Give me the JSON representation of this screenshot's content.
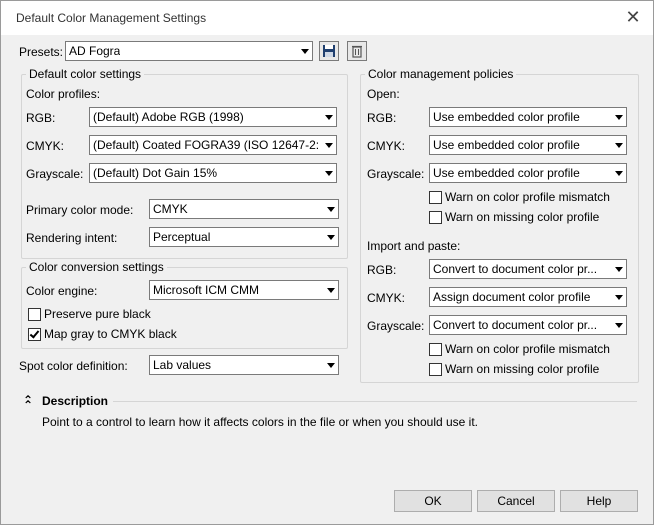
{
  "window": {
    "title": "Default Color Management Settings"
  },
  "presets": {
    "label": "Presets:",
    "value": "AD Fogra",
    "save_icon": "floppy-disk-icon",
    "delete_icon": "trash-icon"
  },
  "default_color": {
    "legend": "Default color settings",
    "profiles_label": "Color profiles:",
    "rgb_label": "RGB:",
    "rgb_value": "(Default) Adobe RGB (1998)",
    "cmyk_label": "CMYK:",
    "cmyk_value": "(Default) Coated FOGRA39 (ISO 12647-2:...",
    "gray_label": "Grayscale:",
    "gray_value": "(Default) Dot Gain 15%",
    "mode_label": "Primary color mode:",
    "mode_value": "CMYK",
    "intent_label": "Rendering intent:",
    "intent_value": "Perceptual"
  },
  "conversion": {
    "legend": "Color conversion settings",
    "engine_label": "Color engine:",
    "engine_value": "Microsoft ICM CMM",
    "preserve_label": "Preserve pure black",
    "preserve_checked": false,
    "map_gray_label": "Map gray to CMYK black",
    "map_gray_checked": true
  },
  "spot": {
    "label": "Spot color definition:",
    "value": "Lab values"
  },
  "policies": {
    "legend": "Color management policies",
    "open_label": "Open:",
    "open_rgb_label": "RGB:",
    "open_rgb_value": "Use embedded color profile",
    "open_cmyk_label": "CMYK:",
    "open_cmyk_value": "Use embedded color profile",
    "open_gray_label": "Grayscale:",
    "open_gray_value": "Use embedded color profile",
    "open_warn_mismatch": "Warn on color profile mismatch",
    "open_warn_missing": "Warn on missing color profile",
    "import_label": "Import and paste:",
    "imp_rgb_label": "RGB:",
    "imp_rgb_value": "Convert to document color pr...",
    "imp_cmyk_label": "CMYK:",
    "imp_cmyk_value": "Assign document color profile",
    "imp_gray_label": "Grayscale:",
    "imp_gray_value": "Convert to document color pr...",
    "imp_warn_mismatch": "Warn on color profile mismatch",
    "imp_warn_missing": "Warn on missing color profile"
  },
  "description": {
    "title": "Description",
    "text": "Point to a control to learn how it affects colors in the file or when you should use it.",
    "collapse_icon": "double-chevron-up-icon"
  },
  "buttons": {
    "ok": "OK",
    "cancel": "Cancel",
    "help": "Help"
  }
}
